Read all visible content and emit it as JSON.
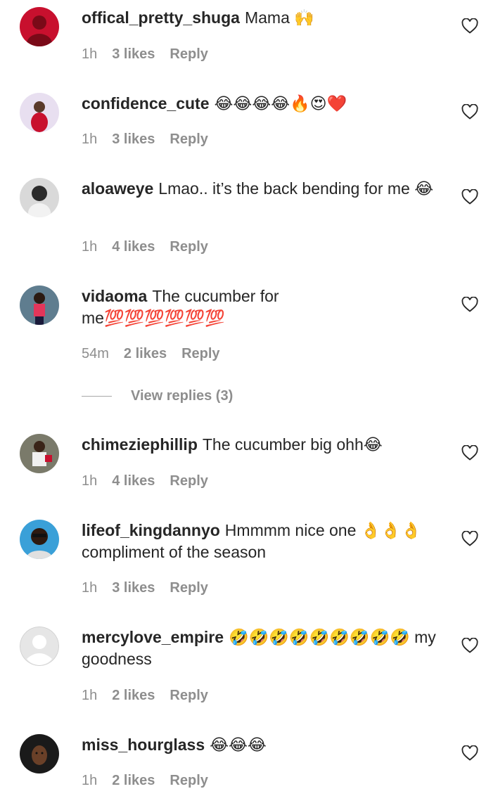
{
  "comments": [
    {
      "username": "offical_pretty_shuga",
      "text": "Mama 🙌",
      "time": "1h",
      "likes": "3 likes",
      "reply": "Reply",
      "avatar": {
        "bg": "#c8102e",
        "fg": "#7a0a18"
      }
    },
    {
      "username": "confidence_cute",
      "text": "😂😂😂😂🔥😍❤️",
      "time": "1h",
      "likes": "3 likes",
      "reply": "Reply",
      "avatar": {
        "bg": "#e8dff0",
        "fg": "#c8102e"
      }
    },
    {
      "username": "aloaweye",
      "text": "Lmao.. it’s the back bending for me 😂",
      "time": "1h",
      "likes": "4 likes",
      "reply": "Reply",
      "avatar": {
        "bg": "#2b2b2b",
        "fg": "#f2f2f2"
      }
    },
    {
      "username": "vidaoma",
      "text": "The cucumber for me💯💯💯💯💯💯",
      "time": "54m",
      "likes": "2 likes",
      "reply": "Reply",
      "avatar": {
        "bg": "#5f7d8f",
        "fg": "#e3365a"
      }
    },
    {
      "username": "chimeziephillip",
      "text": "The cucumber big ohh😂",
      "time": "1h",
      "likes": "4 likes",
      "reply": "Reply",
      "avatar": {
        "bg": "#7a7a6a",
        "fg": "#f0f0f0"
      }
    },
    {
      "username": "lifeof_kingdannyo",
      "text": "Hmmmm nice one 👌👌👌 compliment of the season",
      "time": "1h",
      "likes": "3 likes",
      "reply": "Reply",
      "avatar": {
        "bg": "#3aa0d8",
        "fg": "#2d1a10"
      }
    },
    {
      "username": "mercylove_empire",
      "text": "🤣🤣🤣🤣🤣🤣🤣🤣🤣 my goodness",
      "time": "1h",
      "likes": "2 likes",
      "reply": "Reply",
      "avatar": {
        "bg": "#e6e6e6",
        "fg": "#ffffff"
      }
    },
    {
      "username": "miss_hourglass",
      "text": "😂😂😂",
      "time": "1h",
      "likes": "2 likes",
      "reply": "Reply",
      "avatar": {
        "bg": "#1a1a1a",
        "fg": "#6a4028"
      }
    }
  ],
  "view_replies": "View replies (3)"
}
